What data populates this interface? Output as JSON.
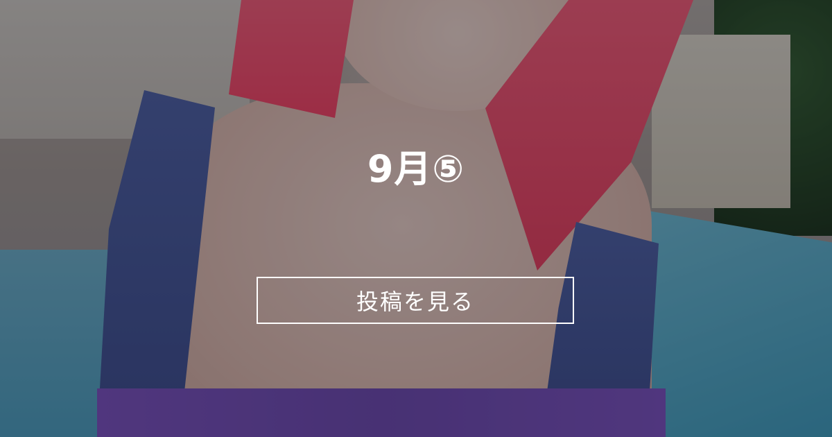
{
  "post": {
    "title": "9月⑤",
    "cta_label": "投稿を見る"
  },
  "colors": {
    "overlay": "#14161c",
    "text": "#ffffff",
    "hair": "#ff4a6b",
    "pool": "#4aa1c4",
    "swimsuit_strap": "#3a4a8f",
    "swimsuit_body": "#7c4fc4"
  }
}
